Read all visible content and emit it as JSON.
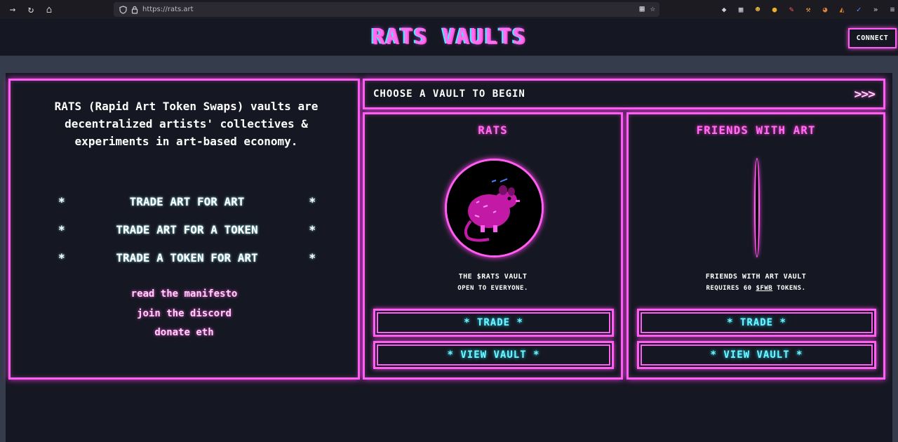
{
  "browser": {
    "url": "https://rats.art",
    "nav": [
      {
        "name": "forward-icon",
        "glyph": "→"
      },
      {
        "name": "reload-icon",
        "glyph": "↻"
      },
      {
        "name": "home-icon",
        "glyph": "⌂"
      }
    ],
    "extensions": [
      {
        "name": "pocket-icon",
        "glyph": "◆"
      },
      {
        "name": "extensions-grid-icon",
        "glyph": "▦"
      },
      {
        "name": "ext-emoji-icon",
        "glyph": "☻"
      },
      {
        "name": "ext-coin-icon",
        "glyph": "●"
      },
      {
        "name": "ext-pen-icon",
        "glyph": "✎"
      },
      {
        "name": "ext-hammer-icon",
        "glyph": "⚒"
      },
      {
        "name": "ext-cookie-icon",
        "glyph": "◕"
      },
      {
        "name": "metamask-fox-icon",
        "glyph": "◭"
      },
      {
        "name": "ext-check-icon",
        "glyph": "✓"
      },
      {
        "name": "overflow-chevron-icon",
        "glyph": "»"
      },
      {
        "name": "menu-icon",
        "glyph": "≡"
      }
    ]
  },
  "header": {
    "title": "RATS VAULTS",
    "connect_label": "CONNECT"
  },
  "intro": {
    "text": "RATS (Rapid Art Token Swaps) vaults are decentralized artists' collectives & experiments in art-based economy.",
    "mottos": [
      {
        "bullet": "*",
        "label": "TRADE ART FOR ART"
      },
      {
        "bullet": "*",
        "label": "TRADE ART FOR A TOKEN"
      },
      {
        "bullet": "*",
        "label": "TRADE A TOKEN FOR ART"
      }
    ],
    "links": [
      "read the manifesto",
      "join the discord",
      "donate eth"
    ]
  },
  "chooser": {
    "label": "CHOOSE A VAULT TO BEGIN",
    "arrows": ">>>"
  },
  "vaults": [
    {
      "name": "RATS",
      "desc_line1": "THE $RATS VAULT",
      "desc_line2": "OPEN TO EVERYONE.",
      "trade_label": "* TRADE *",
      "view_label": "* VIEW VAULT *"
    },
    {
      "name": "FRIENDS WITH ART",
      "desc_line1": "FRIENDS WITH ART VAULT",
      "desc_line2_pre": "REQUIRES 60 ",
      "desc_line2_token": "$FWB",
      "desc_line2_post": " TOKENS.",
      "trade_label": "* TRADE *",
      "view_label": "* VIEW VAULT *"
    }
  ],
  "colors": {
    "neon_pink": "#ff5ef2",
    "neon_cyan": "#6ff7ff",
    "background": "#151822",
    "frame": "#353c4c"
  }
}
